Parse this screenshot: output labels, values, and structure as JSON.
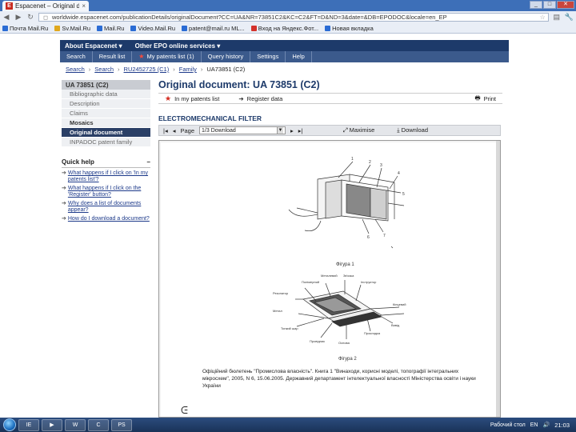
{
  "browser": {
    "tab_title": "Espacenet – Original document",
    "tab_close": "×",
    "url": "worldwide.espacenet.com/publicationDetails/originalDocument?CC=UA&NR=73851C2&KC=C2&FT=D&ND=3&date=&DB=EPODOC&locale=en_EP",
    "bookmarks": [
      {
        "label": "Почта Mail.Ru",
        "color": "#2b6cd4"
      },
      {
        "label": "Sv.Mail.Ru",
        "color": "#e0a81e"
      },
      {
        "label": "Mail.Ru",
        "color": "#2b6cd4"
      },
      {
        "label": "Video.Mail.Ru",
        "color": "#2b6cd4"
      },
      {
        "label": "patent@mail.ru ML...",
        "color": "#2b6cd4"
      },
      {
        "label": "Вход на Яндекс.Фот...",
        "color": "#d4322b"
      },
      {
        "label": "Новая вкладка",
        "color": "#2b6cd4"
      }
    ]
  },
  "epo": {
    "top_links": [
      "About Espacenet ▾",
      "Other EPO online services ▾"
    ],
    "menu": [
      "Search",
      "Result list",
      "My patents list (1)",
      "Query history",
      "Settings",
      "Help"
    ],
    "breadcrumbs": [
      "Search",
      "Search",
      "RU2452725 (C1)",
      "Family",
      "UA73851 (C2)"
    ]
  },
  "sidebar": {
    "header": "UA 73851 (C2)",
    "items": [
      {
        "label": "Bibliographic data",
        "state": "normal"
      },
      {
        "label": "Description",
        "state": "normal"
      },
      {
        "label": "Claims",
        "state": "normal"
      },
      {
        "label": "Mosaics",
        "state": "dark"
      },
      {
        "label": "Original document",
        "state": "active"
      },
      {
        "label": "INPADOC patent family",
        "state": "normal"
      }
    ]
  },
  "quick_help": {
    "title": "Quick help",
    "toggle": "–",
    "items": [
      "What happens if I click on 'In my patents list'?",
      "What happens if I click on the 'Register' button?",
      "Why does a list of documents appear?",
      "How do I download a document?"
    ]
  },
  "main": {
    "title": "Original document: UA 73851 (C2)",
    "actions": {
      "patents_list": "In my patents list",
      "register": "Register data",
      "print": "Print"
    },
    "doc_subtitle": "ELECTROMECHANICAL FILTER",
    "viewer": {
      "page_label": "Page",
      "page_select": "1/3 Download",
      "maximise": "Maximise",
      "download": "Download"
    },
    "figure_captions": [
      "Фігура 1",
      "Фігура 2"
    ],
    "doc_text": "Офіційний бюлетень \"Промислова власність\". Книга 1 \"Винаходи, корисні моделі, топографії інтегральних мікросхем\", 2005, N 6, 15.06.2005. Державний департамент інтелектуальної власності Міністерства освіти і науки України"
  },
  "taskbar": {
    "apps": [
      "IE",
      "▶",
      "W",
      "C",
      "PS"
    ],
    "tray_text": "Рабочий стол",
    "lang": "EN",
    "clock": "21:03"
  }
}
